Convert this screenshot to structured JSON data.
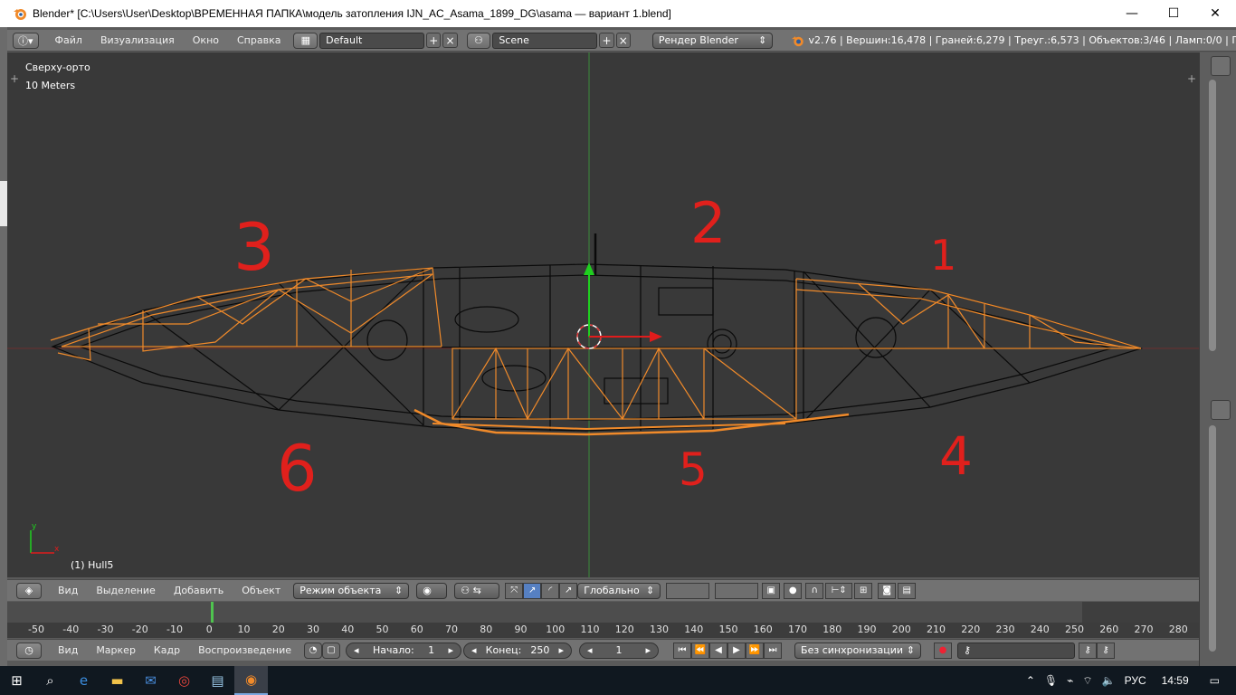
{
  "window": {
    "title": "Blender* [C:\\Users\\User\\Desktop\\ВРЕМЕННАЯ ПАПКА\\модель затопления IJN_AC_Asama_1899_DG\\asama — вариант 1.blend]",
    "minimize": "—",
    "maximize": "☐",
    "close": "✕"
  },
  "infobar": {
    "menus": [
      "Файл",
      "Визуализация",
      "Окно",
      "Справка"
    ],
    "layout": "Default",
    "scene": "Scene",
    "render_engine": "Рендер Blender",
    "stats": "v2.76 | Вершин:16,478 | Граней:6,279 | Треуг.:6,573 | Объектов:3/46 | Ламп:0/0 | Пам.:"
  },
  "viewport": {
    "view_name": "Сверху-орто",
    "scale": "10 Meters",
    "object_label": "(1) Hull5",
    "axis_y": "y",
    "axis_x": "x",
    "annotations": [
      "1",
      "2",
      "3",
      "4",
      "5",
      "6"
    ],
    "colors": {
      "background": "#393939",
      "selected": "#f08a2a",
      "wire": "#0a0a0a",
      "annotation": "#e0201c"
    }
  },
  "view3d_header": {
    "menus": [
      "Вид",
      "Выделение",
      "Добавить",
      "Объект"
    ],
    "mode": "Режим объекта",
    "orientation": "Глобально"
  },
  "timeline": {
    "ticks": [
      "-50",
      "-40",
      "-30",
      "-20",
      "-10",
      "0",
      "10",
      "20",
      "30",
      "40",
      "50",
      "60",
      "70",
      "80",
      "90",
      "100",
      "110",
      "120",
      "130",
      "140",
      "150",
      "160",
      "170",
      "180",
      "190",
      "200",
      "210",
      "220",
      "230",
      "240",
      "250",
      "260",
      "270",
      "280"
    ],
    "current_frame": 1
  },
  "timeline_header": {
    "menus": [
      "Вид",
      "Маркер",
      "Кадр",
      "Воспроизведение"
    ],
    "start_label": "Начало:",
    "start_value": "1",
    "end_label": "Конец:",
    "end_value": "250",
    "current_value": "1",
    "sync": "Без синхронизации"
  },
  "taskbar": {
    "lang": "РУС",
    "time": "14:59"
  }
}
